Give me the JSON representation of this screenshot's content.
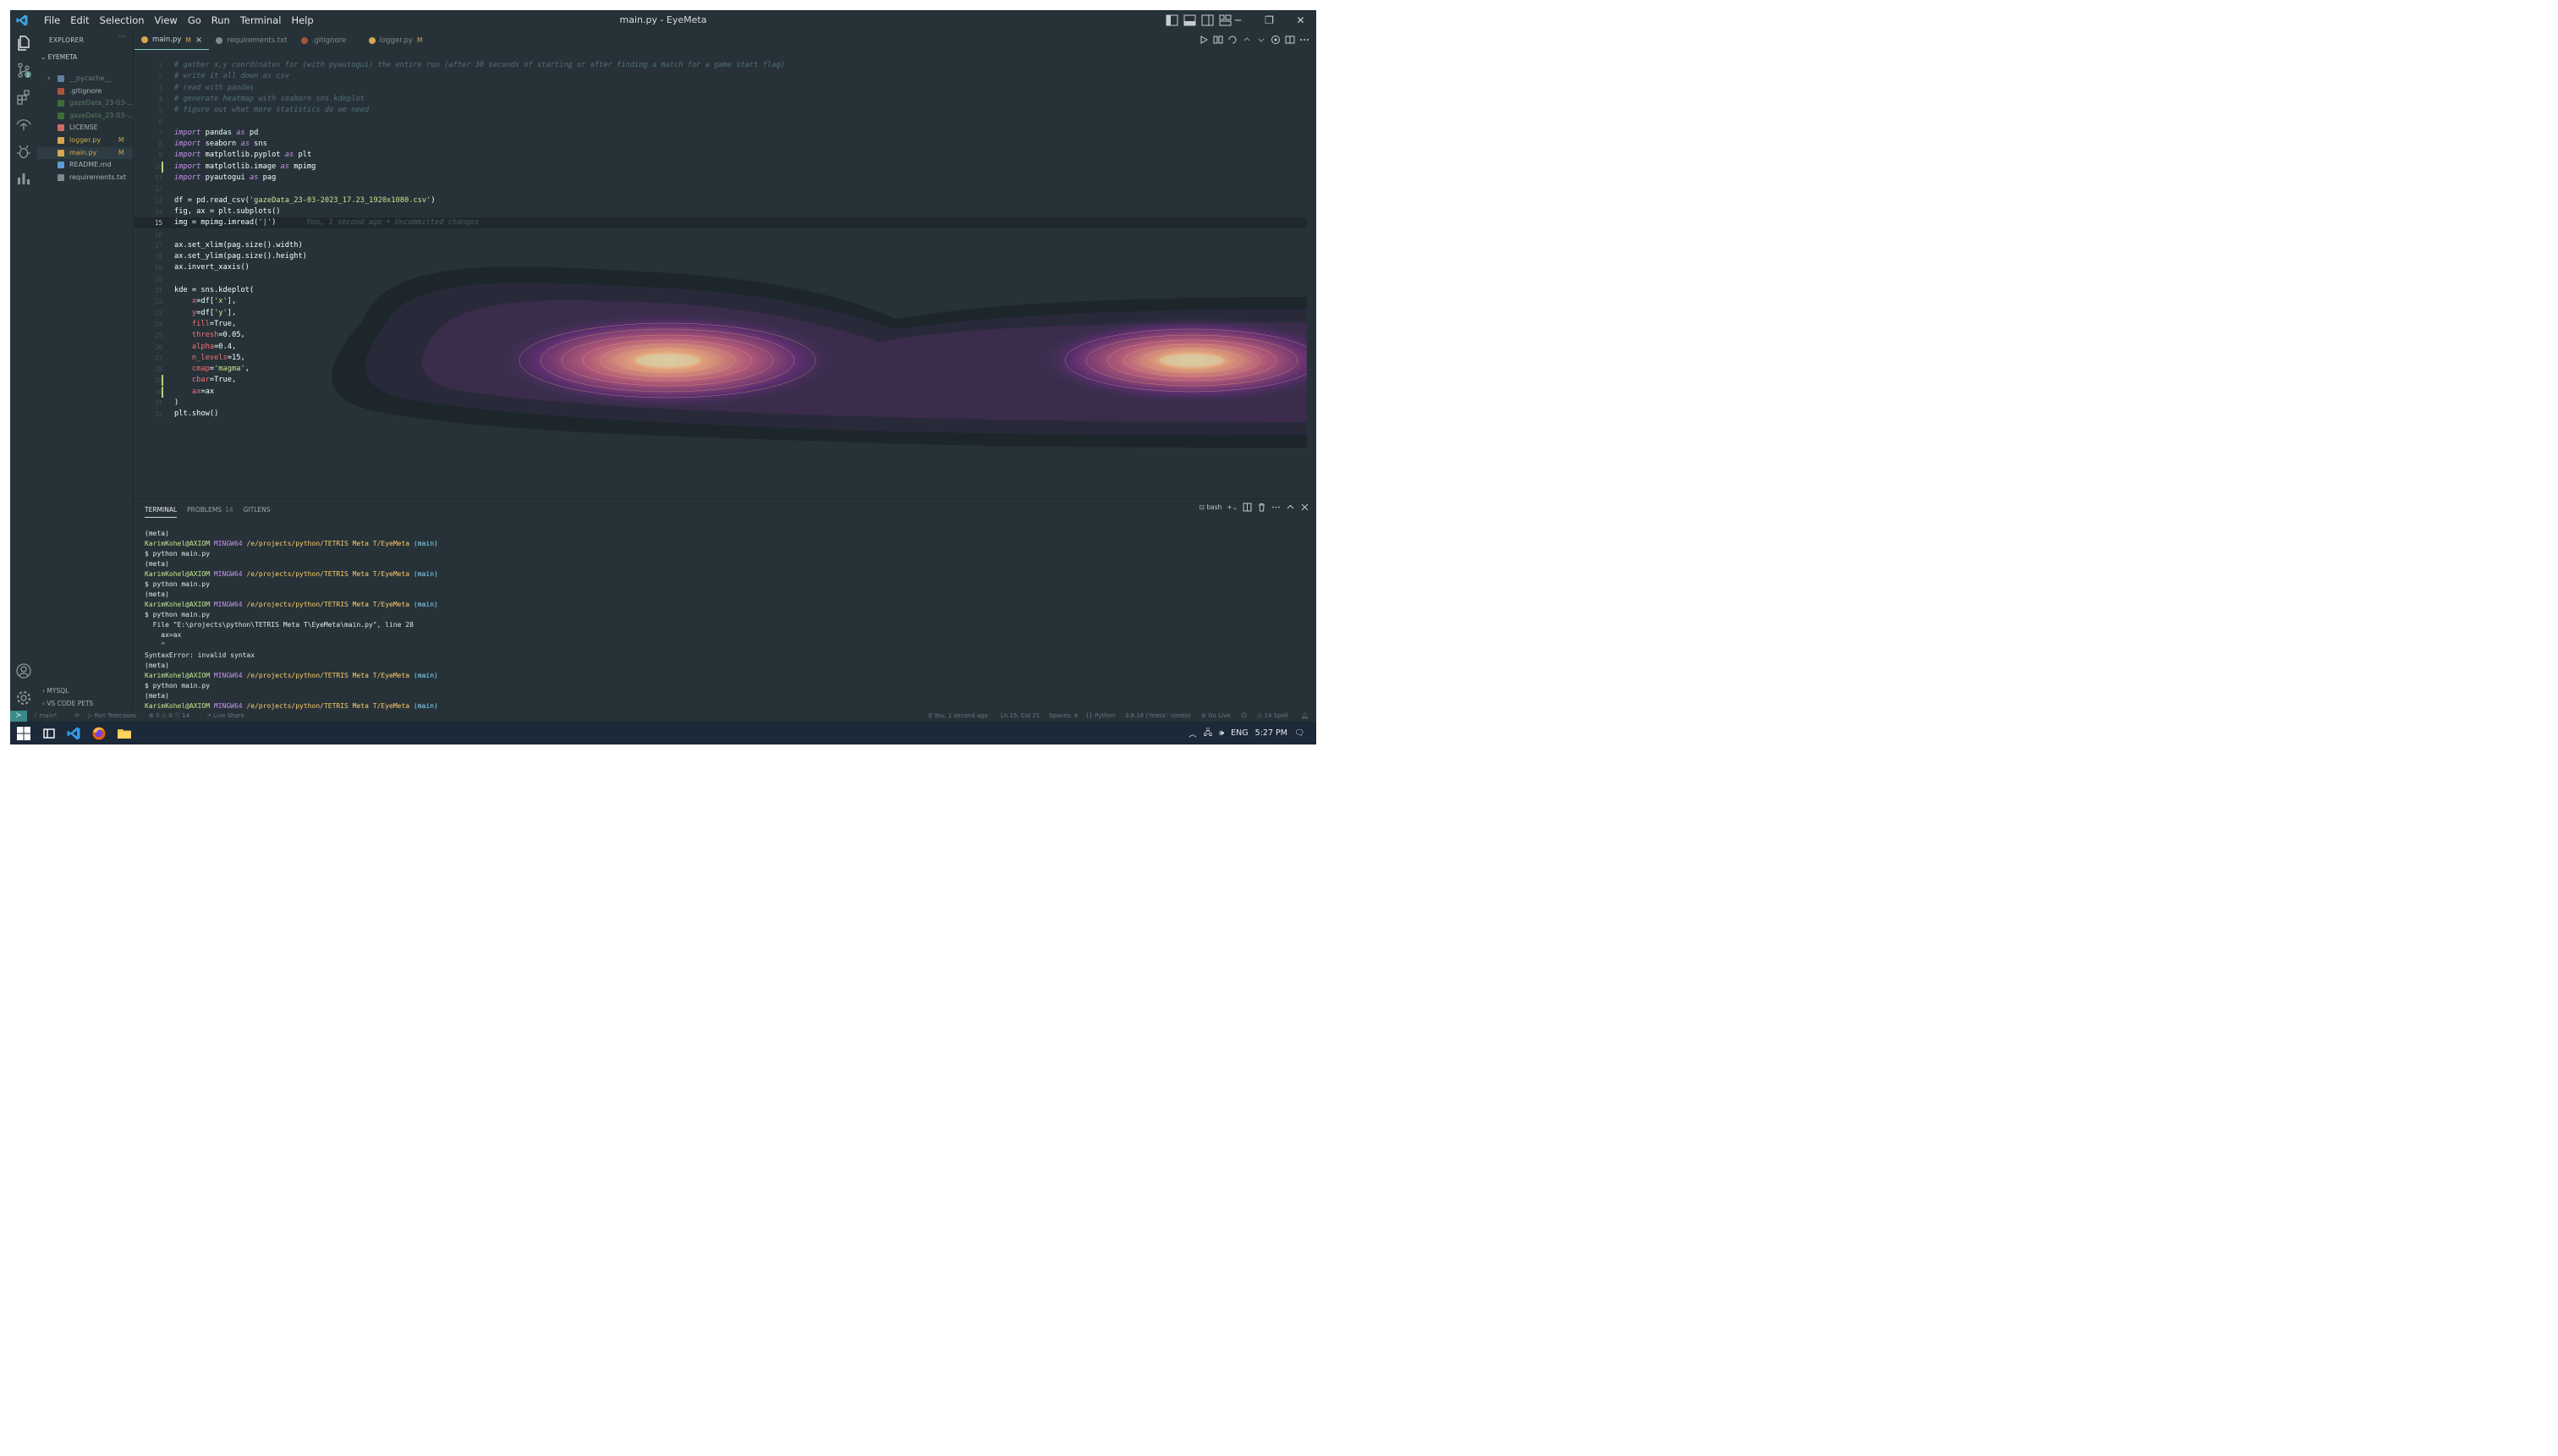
{
  "window": {
    "title": "main.py - EyeMeta"
  },
  "menu": [
    "File",
    "Edit",
    "Selection",
    "View",
    "Go",
    "Run",
    "Terminal",
    "Help"
  ],
  "explorer": {
    "header": "EXPLORER",
    "more": "···",
    "project": "EYEMETA",
    "items": [
      {
        "name": "__pycache__",
        "icon": "folder-icon",
        "color": "#5f7fa3",
        "badge": ""
      },
      {
        "name": ".gitignore",
        "icon": "git-icon",
        "color": "#a9543a",
        "badge": ""
      },
      {
        "name": "gazeData_23-03-...",
        "icon": "csv-file-icon",
        "color": "#3e6b39",
        "badge": ""
      },
      {
        "name": "gazeData_23-03-...",
        "icon": "csv-file-icon",
        "color": "#3e6b39",
        "badge": ""
      },
      {
        "name": "LICENSE",
        "icon": "license-icon",
        "color": "#cf6a6a",
        "badge": ""
      },
      {
        "name": "logger.py",
        "icon": "python-icon",
        "color": "#d6a84e",
        "badge": "M"
      },
      {
        "name": "main.py",
        "icon": "python-icon",
        "color": "#d6a84e",
        "badge": "M"
      },
      {
        "name": "README.md",
        "icon": "info-icon",
        "color": "#5b9bd5",
        "badge": ""
      },
      {
        "name": "requirements.txt",
        "icon": "text-file-icon",
        "color": "#7d8a91",
        "badge": ""
      }
    ],
    "bottom": [
      "MYSQL",
      "VS CODE PETS"
    ]
  },
  "tabs": [
    {
      "label": "main.py",
      "mod": "M",
      "active": true,
      "icon": "python-icon",
      "color": "#d6a84e"
    },
    {
      "label": "requirements.txt",
      "mod": "",
      "active": false,
      "icon": "text-file-icon",
      "color": "#7d8a91"
    },
    {
      "label": ".gitignore",
      "mod": "",
      "active": false,
      "icon": "git-icon",
      "color": "#a9543a"
    },
    {
      "label": "logger.py",
      "mod": "M",
      "active": false,
      "icon": "python-icon",
      "color": "#d6a84e"
    }
  ],
  "editor": {
    "current_line": 15,
    "git_blame": "You, 1 second ago • Uncommitted changes",
    "lines": [
      [
        [
          "cmt",
          "# gather x,y coordinates for (with pyautogui) the entire run (after 30 seconds of starting or after finding a match for a game start flag)"
        ]
      ],
      [
        [
          "cmt",
          "# write it all down as csv"
        ]
      ],
      [
        [
          "cmt",
          "# read with pandas"
        ]
      ],
      [
        [
          "cmt",
          "# generate heatmap with seaborn sns.kdeplot"
        ]
      ],
      [
        [
          "cmt",
          "# figure out what more statistics do we need"
        ]
      ],
      [],
      [
        [
          "kw",
          "import"
        ],
        [
          "id",
          " pandas "
        ],
        [
          "kw",
          "as"
        ],
        [
          "id",
          " pd"
        ]
      ],
      [
        [
          "kw",
          "import"
        ],
        [
          "id",
          " seaborn "
        ],
        [
          "kw",
          "as"
        ],
        [
          "id",
          " sns"
        ]
      ],
      [
        [
          "kw",
          "import"
        ],
        [
          "id",
          " matplotlib.pyplot "
        ],
        [
          "kw",
          "as"
        ],
        [
          "id",
          " plt"
        ]
      ],
      [
        [
          "kw",
          "import"
        ],
        [
          "id",
          " matplotlib.image "
        ],
        [
          "kw",
          "as"
        ],
        [
          "id",
          " mpimg"
        ]
      ],
      [
        [
          "kw",
          "import"
        ],
        [
          "id",
          " pyautogui "
        ],
        [
          "kw",
          "as"
        ],
        [
          "id",
          " pag"
        ]
      ],
      [],
      [
        [
          "id",
          "df = pd.read_csv("
        ],
        [
          "str",
          "'gazeData_23-03-2023_17.23_1920x1080.csv'"
        ],
        [
          "id",
          ")"
        ]
      ],
      [
        [
          "id",
          "fig, ax = plt.subplots()"
        ]
      ],
      [
        [
          "id",
          "img = mpimg.imread("
        ],
        [
          "str",
          "'"
        ],
        [
          "id",
          "|"
        ],
        [
          "str",
          "'"
        ],
        [
          "id",
          ")"
        ]
      ],
      [],
      [
        [
          "id",
          "ax.set_xlim(pag.size().width)"
        ]
      ],
      [
        [
          "id",
          "ax.set_ylim(pag.size().height)"
        ]
      ],
      [
        [
          "id",
          "ax.invert_xaxis()"
        ]
      ],
      [],
      [
        [
          "id",
          "kde = sns.kdeplot("
        ]
      ],
      [
        [
          "arg",
          "    x"
        ],
        [
          "id",
          "=df["
        ],
        [
          "str",
          "'x'"
        ],
        [
          "id",
          "],"
        ]
      ],
      [
        [
          "arg",
          "    y"
        ],
        [
          "id",
          "=df["
        ],
        [
          "str",
          "'y'"
        ],
        [
          "id",
          "],"
        ]
      ],
      [
        [
          "arg",
          "    fill"
        ],
        [
          "id",
          "=True,"
        ]
      ],
      [
        [
          "arg",
          "    thresh"
        ],
        [
          "id",
          "=0.05,"
        ]
      ],
      [
        [
          "arg",
          "    alpha"
        ],
        [
          "id",
          "=0.4,"
        ]
      ],
      [
        [
          "arg",
          "    n_levels"
        ],
        [
          "id",
          "=15,"
        ]
      ],
      [
        [
          "arg",
          "    cmap"
        ],
        [
          "id",
          "="
        ],
        [
          "str",
          "'magma'"
        ],
        [
          "id",
          ","
        ]
      ],
      [
        [
          "arg",
          "    cbar"
        ],
        [
          "id",
          "=True,"
        ]
      ],
      [
        [
          "arg",
          "    ax"
        ],
        [
          "id",
          "=ax"
        ]
      ],
      [
        [
          "id",
          ")"
        ]
      ],
      [
        [
          "id",
          "plt.show()"
        ]
      ]
    ],
    "gutter_marks": [
      10,
      29,
      30
    ]
  },
  "terminal": {
    "tabs": [
      {
        "label": "TERMINAL",
        "count": ""
      },
      {
        "label": "PROBLEMS",
        "count": "14"
      },
      {
        "label": "GITLENS",
        "count": ""
      }
    ],
    "shell": "bash",
    "prompt": {
      "user": "KarimKohel@AXIOM",
      "host": "MINGW64",
      "path": "/e/projects/python/TETRIS Meta T/EyeMeta",
      "branch": "(main)"
    },
    "lines": [
      [
        "plain",
        "(meta)"
      ],
      [
        "prompt",
        ""
      ],
      [
        "plain",
        "$ python main.py"
      ],
      [
        "plain",
        "(meta)"
      ],
      [
        "prompt",
        ""
      ],
      [
        "plain",
        "$ python main.py"
      ],
      [
        "plain",
        "(meta)"
      ],
      [
        "prompt",
        ""
      ],
      [
        "plain",
        "$ python main.py"
      ],
      [
        "plain",
        "  File \"E:\\projects\\python\\TETRIS Meta T\\EyeMeta\\main.py\", line 28"
      ],
      [
        "plain",
        "    ax=ax"
      ],
      [
        "plain",
        "    ^"
      ],
      [
        "plain",
        "SyntaxError: invalid syntax"
      ],
      [
        "plain",
        "(meta)"
      ],
      [
        "prompt",
        ""
      ],
      [
        "plain",
        "$ python main.py"
      ],
      [
        "plain",
        "(meta)"
      ],
      [
        "prompt",
        ""
      ],
      [
        "cursor",
        "$ "
      ]
    ]
  },
  "status": {
    "left": [
      "main*",
      "Run Testcases",
      "⊗ 0 ⚠ 0 ⓘ 14",
      "Live Share"
    ],
    "right": [
      "You, 1 second ago",
      "Ln 15, Col 21",
      "Spaces: 4",
      "Python",
      "3.8.16 ('meta': conda)",
      "Go Live",
      "14 Spell"
    ]
  },
  "taskbar": {
    "time": "5:27 PM",
    "lang": "ENG"
  },
  "colors": {
    "bg": "#263238",
    "accent": "#80cbc4",
    "status_remote": "#3a8a88",
    "taskbar": "#1b2939"
  }
}
